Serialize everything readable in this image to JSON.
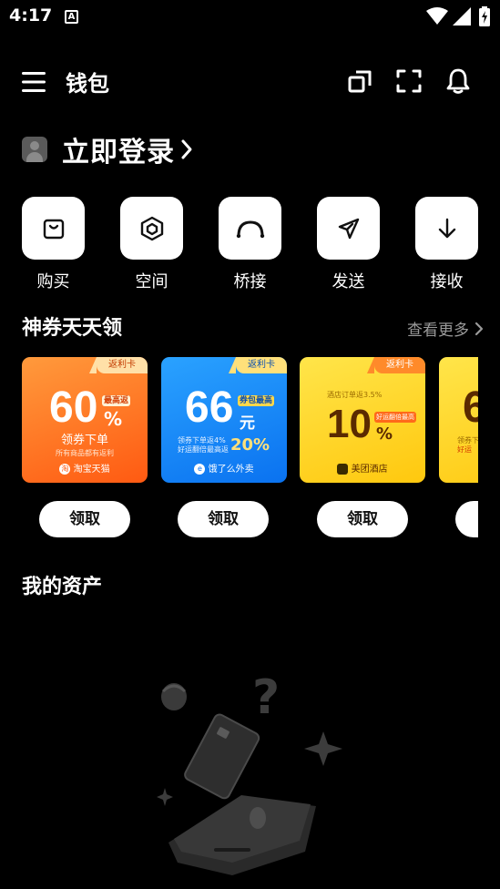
{
  "status_bar": {
    "time": "4:17",
    "a_badge": "A"
  },
  "header": {
    "title": "钱包"
  },
  "login": {
    "label": "立即登录"
  },
  "actions": [
    {
      "label": "购买",
      "icon": "shopping-bag-icon"
    },
    {
      "label": "空间",
      "icon": "hexagon-space-icon"
    },
    {
      "label": "桥接",
      "icon": "bridge-arc-icon"
    },
    {
      "label": "发送",
      "icon": "send-plane-icon"
    },
    {
      "label": "接收",
      "icon": "arrow-down-icon"
    }
  ],
  "coupons_section": {
    "title": "神券天天领",
    "more": "查看更多",
    "claim_label": "领取",
    "coupons": [
      {
        "tag": "返利卡",
        "value": "60",
        "unit": "%",
        "badge": "最高返",
        "line1": "领券下单",
        "line2": "所有商品都有返利",
        "brand": "淘宝天猫",
        "color": "#ff6a1a"
      },
      {
        "tag": "返利卡",
        "value": "66",
        "unit": "元",
        "badge": "券包最高",
        "line1": "领券下单返4%",
        "line2": "好运翻倍最高返",
        "extra": "20%",
        "brand": "饿了么外卖",
        "color": "#1a8cff"
      },
      {
        "tag": "返利卡",
        "value": "10",
        "unit": "%",
        "badge": "好运翻倍最高",
        "line1": "酒店订单返3.5%",
        "brand": "美团酒店",
        "color": "#ffd21a"
      },
      {
        "tag": "",
        "value": "6",
        "line1": "领券下",
        "line2": "好运",
        "color": "#ffd21a"
      }
    ]
  },
  "assets": {
    "title": "我的资产"
  }
}
